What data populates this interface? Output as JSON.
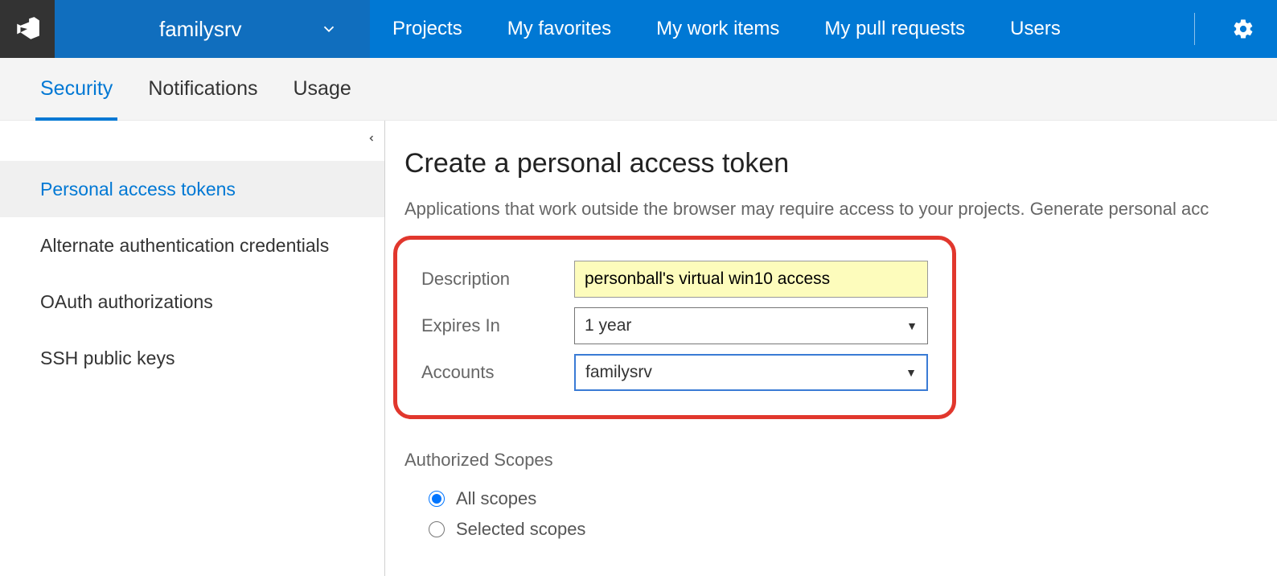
{
  "header": {
    "org_name": "familysrv",
    "nav": {
      "projects": "Projects",
      "favorites": "My favorites",
      "work_items": "My work items",
      "pull_requests": "My pull requests",
      "users": "Users"
    }
  },
  "tabs": {
    "security": "Security",
    "notifications": "Notifications",
    "usage": "Usage"
  },
  "sidebar": {
    "items": [
      "Personal access tokens",
      "Alternate authentication credentials",
      "OAuth authorizations",
      "SSH public keys"
    ]
  },
  "main": {
    "title": "Create a personal access token",
    "description": "Applications that work outside the browser may require access to your projects. Generate personal acc",
    "form": {
      "description_label": "Description",
      "description_value": "personball's virtual win10 access",
      "expires_label": "Expires In",
      "expires_value": "1 year",
      "accounts_label": "Accounts",
      "accounts_value": "familysrv"
    },
    "scopes": {
      "label": "Authorized Scopes",
      "all": "All scopes",
      "selected": "Selected scopes"
    }
  }
}
